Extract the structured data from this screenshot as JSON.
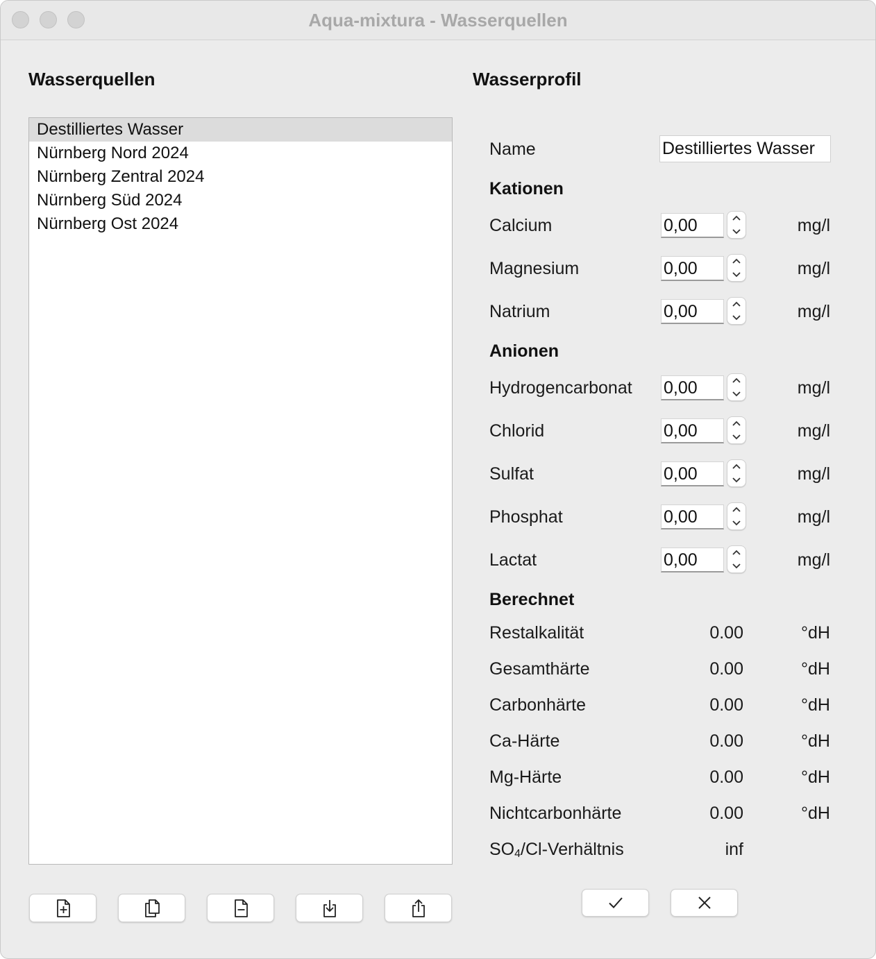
{
  "window": {
    "title": "Aqua-mixtura - Wasserquellen"
  },
  "sources": {
    "title": "Wasserquellen",
    "items": [
      {
        "label": "Destilliertes Wasser",
        "selected": true
      },
      {
        "label": "Nürnberg Nord 2024",
        "selected": false
      },
      {
        "label": "Nürnberg Zentral 2024",
        "selected": false
      },
      {
        "label": "Nürnberg Süd 2024",
        "selected": false
      },
      {
        "label": "Nürnberg Ost 2024",
        "selected": false
      }
    ],
    "toolbar": [
      {
        "icon": "new-document-icon"
      },
      {
        "icon": "duplicate-icon"
      },
      {
        "icon": "remove-document-icon"
      },
      {
        "icon": "import-icon"
      },
      {
        "icon": "share-icon"
      }
    ]
  },
  "profile": {
    "title": "Wasserprofil",
    "name_label": "Name",
    "name_value": "Destilliertes Wasser",
    "cations_title": "Kationen",
    "cations": [
      {
        "label": "Calcium",
        "value": "0,00",
        "unit": "mg/l"
      },
      {
        "label": "Magnesium",
        "value": "0,00",
        "unit": "mg/l"
      },
      {
        "label": "Natrium",
        "value": "0,00",
        "unit": "mg/l"
      }
    ],
    "anions_title": "Anionen",
    "anions": [
      {
        "label": "Hydrogencarbonat",
        "value": "0,00",
        "unit": "mg/l"
      },
      {
        "label": "Chlorid",
        "value": "0,00",
        "unit": "mg/l"
      },
      {
        "label": "Sulfat",
        "value": "0,00",
        "unit": "mg/l"
      },
      {
        "label": "Phosphat",
        "value": "0,00",
        "unit": "mg/l"
      },
      {
        "label": "Lactat",
        "value": "0,00",
        "unit": "mg/l"
      }
    ],
    "computed_title": "Berechnet",
    "computed": [
      {
        "label": "Restalkalität",
        "value": "0.00",
        "unit": "°dH"
      },
      {
        "label": "Gesamthärte",
        "value": "0.00",
        "unit": "°dH"
      },
      {
        "label": "Carbonhärte",
        "value": "0.00",
        "unit": "°dH"
      },
      {
        "label": "Ca-Härte",
        "value": "0.00",
        "unit": "°dH"
      },
      {
        "label": "Mg-Härte",
        "value": "0.00",
        "unit": "°dH"
      },
      {
        "label": "Nichtcarbonhärte",
        "value": "0.00",
        "unit": "°dH"
      }
    ],
    "ratio": {
      "label_prefix": "SO",
      "label_sub": "4",
      "label_suffix": "/Cl-Verhältnis",
      "value": "inf"
    },
    "actions": [
      {
        "icon": "checkmark-icon"
      },
      {
        "icon": "close-icon"
      }
    ]
  }
}
